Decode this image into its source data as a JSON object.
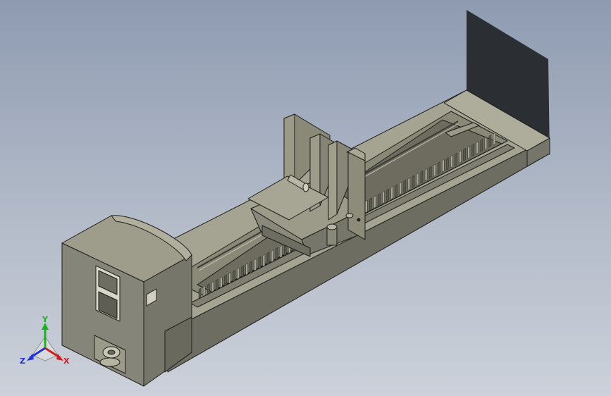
{
  "viewport": {
    "background_top": "#8e9bb1",
    "background_bottom": "#ccd1da"
  },
  "model": {
    "color_face": "#8c8b7c",
    "color_top": "#a8a795",
    "color_dark": "#5d5c52",
    "color_edge": "#1d1d1a"
  },
  "triad": {
    "x_label": "X",
    "y_label": "Y",
    "z_label": "Z",
    "x_color": "#d01c1c",
    "y_color": "#17b31a",
    "z_color": "#1d35d8"
  }
}
